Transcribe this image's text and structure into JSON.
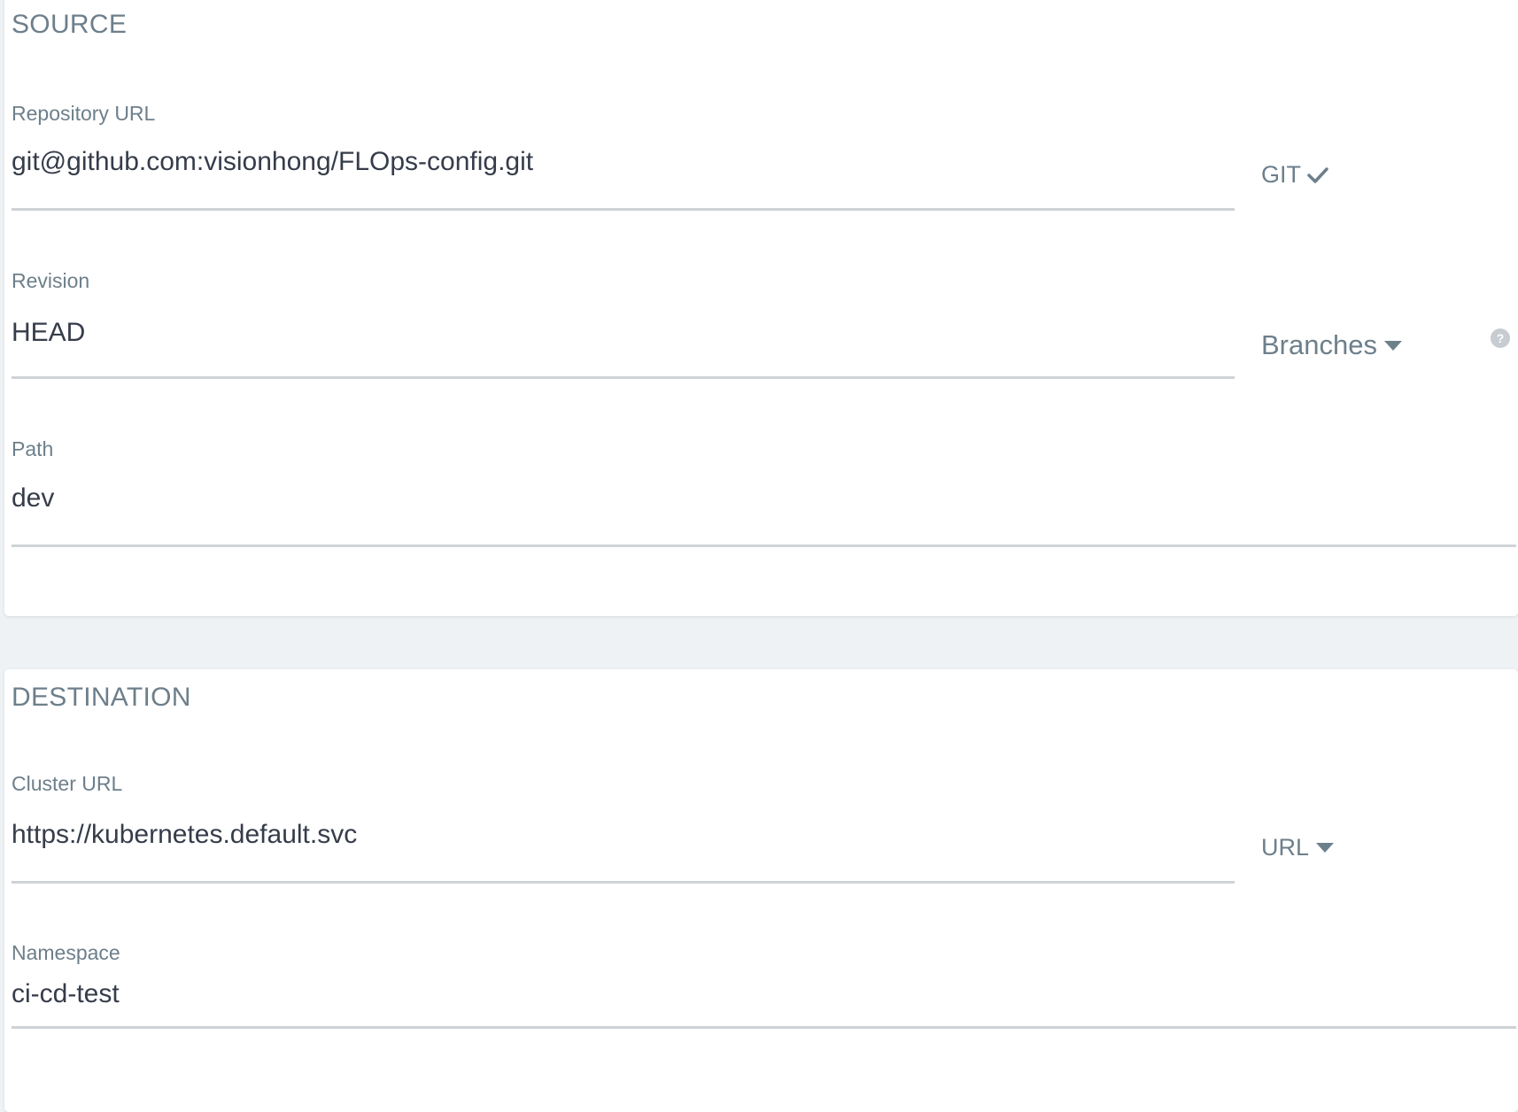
{
  "source": {
    "title": "SOURCE",
    "repository_url": {
      "label": "Repository URL",
      "value": "git@github.com:visionhong/FLOps-config.git",
      "type_label": "GIT"
    },
    "revision": {
      "label": "Revision",
      "value": "HEAD",
      "selector_label": "Branches",
      "help_glyph": "?"
    },
    "path": {
      "label": "Path",
      "value": "dev"
    }
  },
  "destination": {
    "title": "DESTINATION",
    "cluster_url": {
      "label": "Cluster URL",
      "value": "https://kubernetes.default.svc",
      "selector_label": "URL"
    },
    "namespace": {
      "label": "Namespace",
      "value": "ci-cd-test"
    }
  },
  "colors": {
    "background": "#eef2f5",
    "panel": "#ffffff",
    "label": "#6d7f8b",
    "value_text": "#363c4a",
    "underline": "#cfd3d6",
    "help_icon": "#c6ccd1"
  },
  "icons": {
    "git_status": "check-icon",
    "branches_dropdown": "caret-down-icon",
    "url_dropdown": "caret-down-icon",
    "revision_help": "question-circle-icon"
  }
}
